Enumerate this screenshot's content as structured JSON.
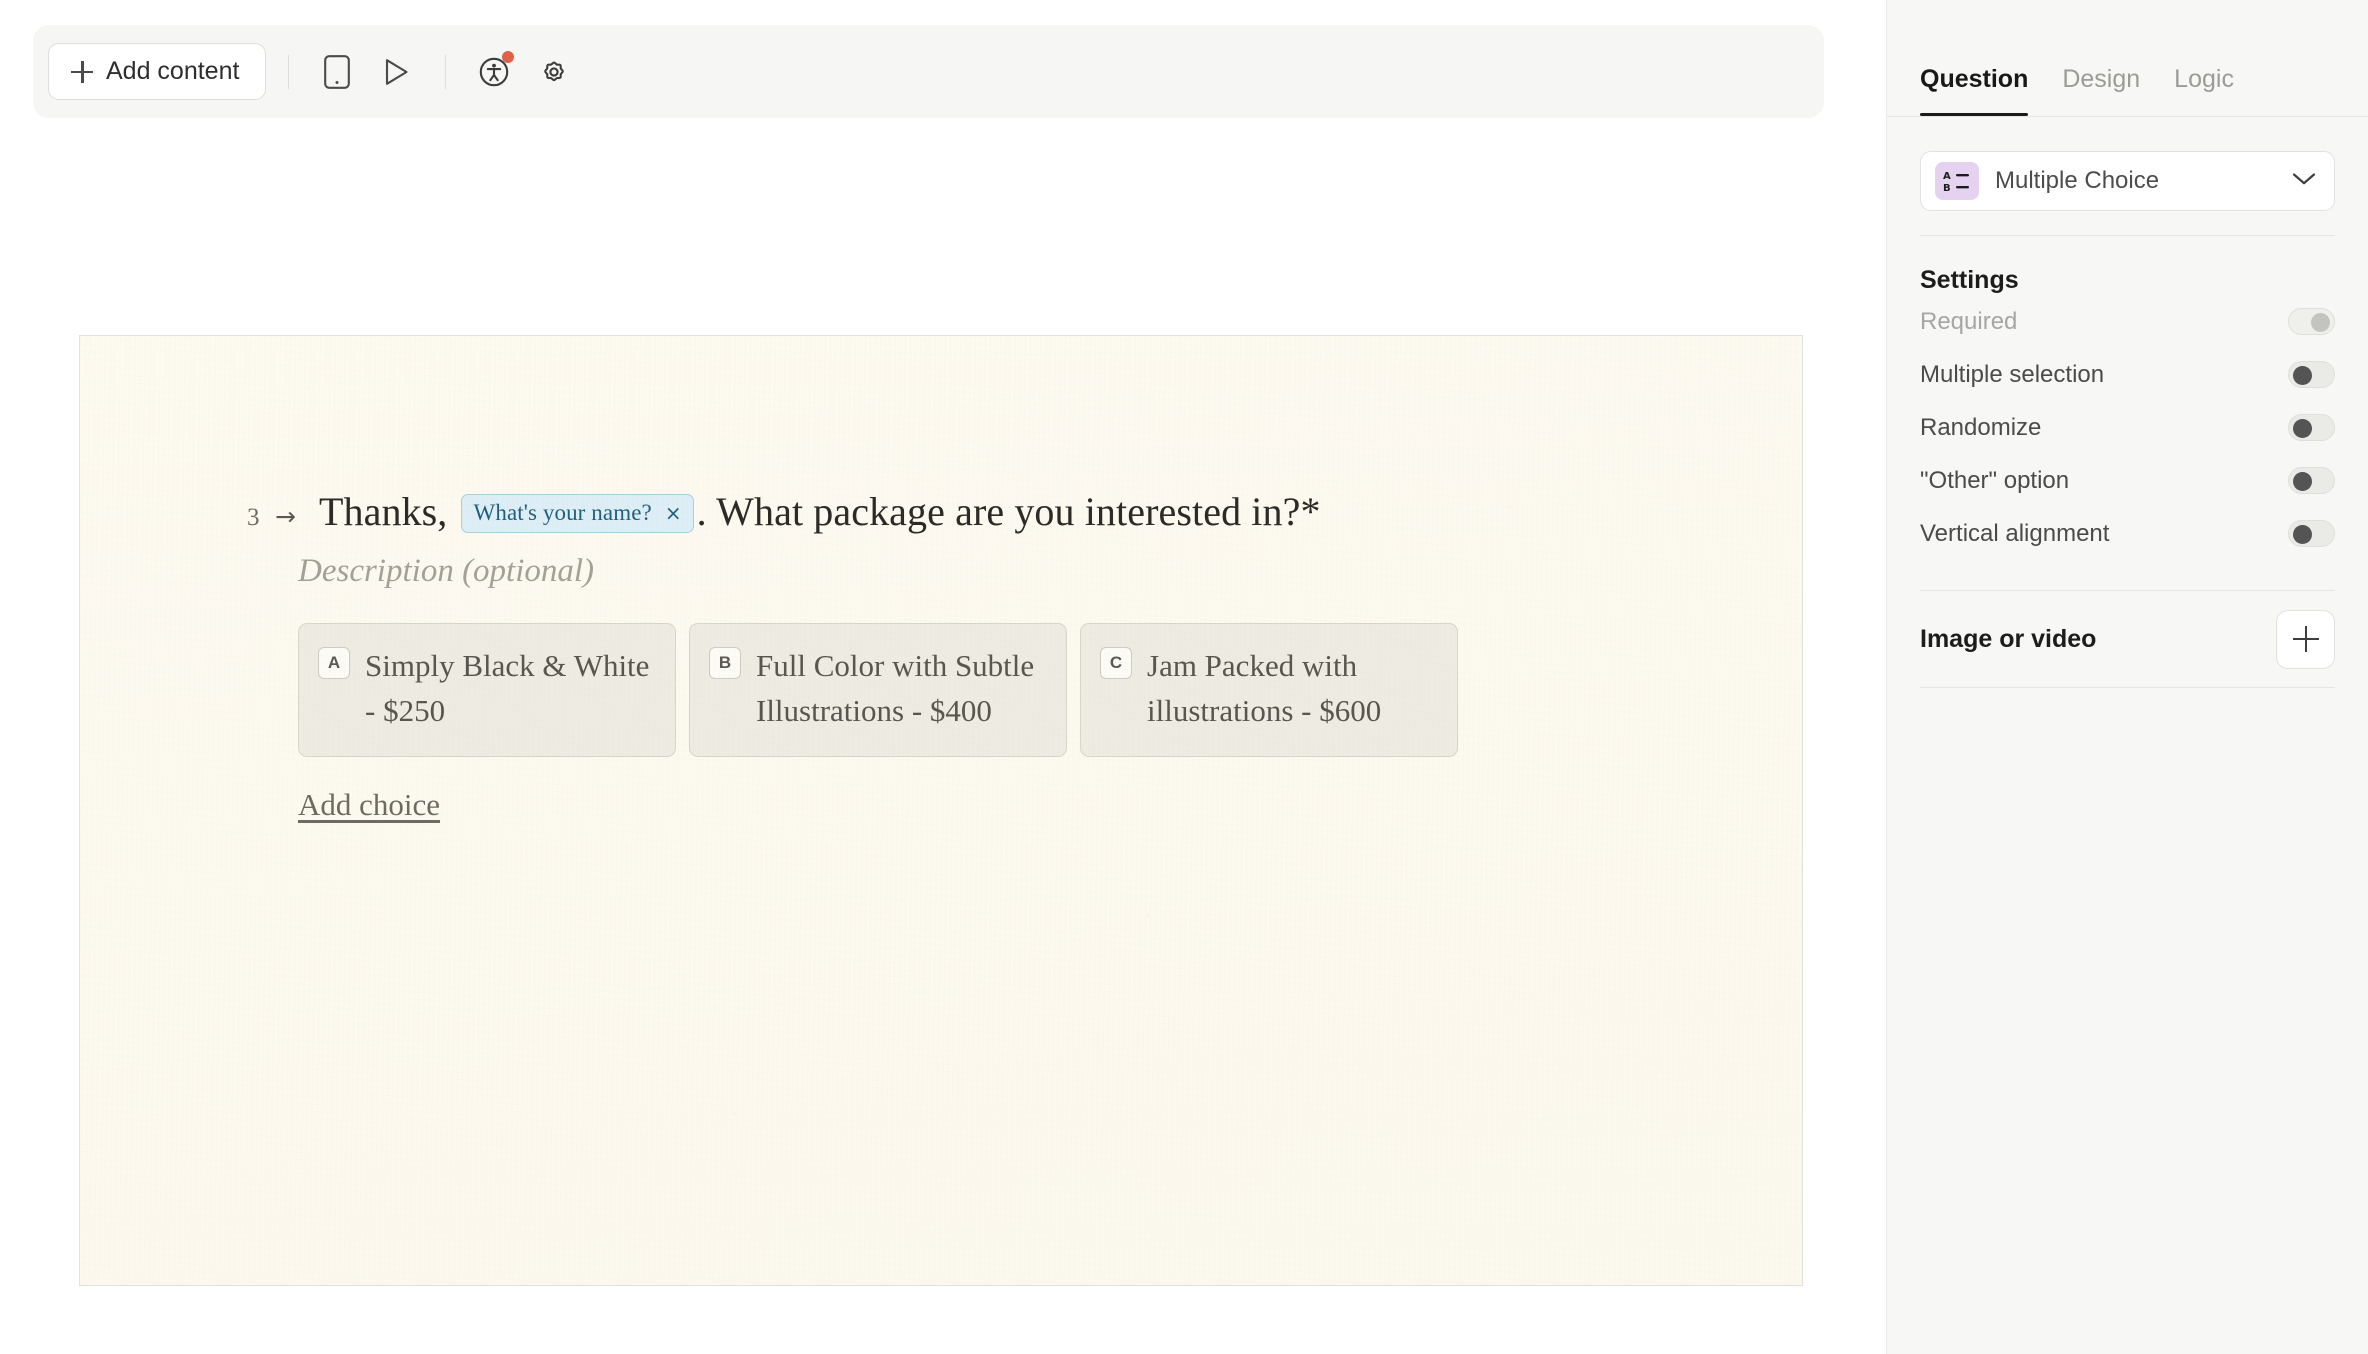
{
  "toolbar": {
    "add_content_label": "Add content",
    "icons": [
      {
        "name": "mobile-preview-icon",
        "title": "Mobile preview"
      },
      {
        "name": "play-preview-icon",
        "title": "Preview"
      },
      {
        "name": "accessibility-icon",
        "title": "Accessibility",
        "badge": true
      },
      {
        "name": "settings-gear-icon",
        "title": "Settings"
      }
    ],
    "notification_color": "#e0614a"
  },
  "canvas": {
    "question": {
      "index": "3",
      "arrow": "→",
      "title_before": "Thanks,",
      "reference_pill": {
        "label": "What's your name?",
        "remove_icon": "×"
      },
      "title_after": ". What package are you interested in?*",
      "description_placeholder": "Description (optional)",
      "choices": [
        {
          "letter": "A",
          "text": "Simply Black & White - $250"
        },
        {
          "letter": "B",
          "text": "Full Color with Subtle Illustrations - $400"
        },
        {
          "letter": "C",
          "text": "Jam Packed with illustrations - $600"
        }
      ],
      "add_choice_label": "Add choice"
    },
    "paper_color": "#fcf9ef",
    "choice_card_color": "#eeece2",
    "pill_color": "#ddeef6"
  },
  "panel": {
    "tabs": [
      {
        "label": "Question",
        "active": true
      },
      {
        "label": "Design",
        "active": false
      },
      {
        "label": "Logic",
        "active": false
      }
    ],
    "question_type": {
      "label": "Multiple Choice",
      "icon_name": "multiple-choice-icon",
      "icon_bg": "#e4d2f0",
      "icon_line_a": "A",
      "icon_line_b": "B"
    },
    "settings_title": "Settings",
    "settings": [
      {
        "label": "Required",
        "on": false,
        "disabled": true
      },
      {
        "label": "Multiple selection",
        "on": false,
        "disabled": false
      },
      {
        "label": "Randomize",
        "on": false,
        "disabled": false
      },
      {
        "label": "\"Other\" option",
        "on": false,
        "disabled": false
      },
      {
        "label": "Vertical alignment",
        "on": false,
        "disabled": false
      }
    ],
    "media": {
      "label": "Image or video",
      "add_icon": "plus-icon"
    }
  }
}
